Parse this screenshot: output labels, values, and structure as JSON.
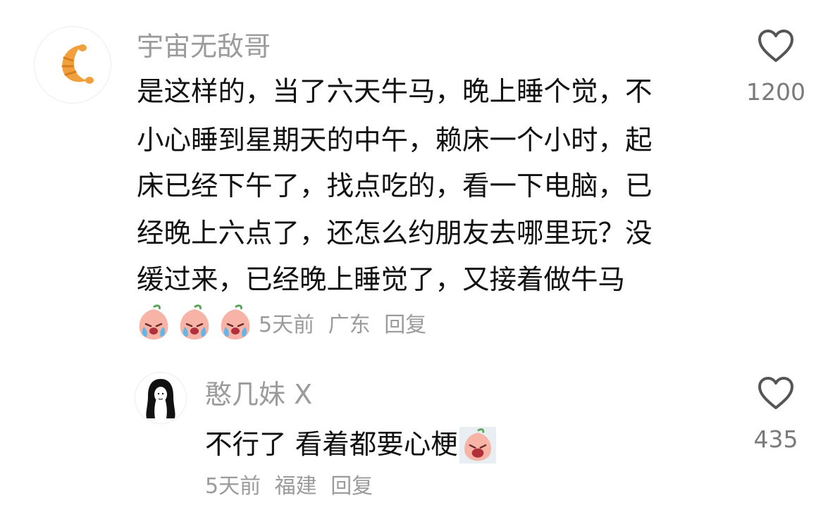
{
  "comment": {
    "username": "宇宙无敌哥",
    "avatar_icon": "croissant-icon",
    "text_lines": [
      "是这样的，当了六天牛马，晚上睡个觉，不",
      "小心睡到星期天的中午，赖床一个小时，起",
      "床已经下午了，找点吃的，看一下电脑，已",
      "经晚上六点了，还怎么约朋友去哪里玩？没",
      "缓过来，已经晚上睡觉了，又接着做牛马"
    ],
    "emojis": [
      "crying-peach-emoji",
      "crying-peach-emoji",
      "crying-peach-emoji"
    ],
    "time": "5天前",
    "location": "广东",
    "reply_label": "回复",
    "like_icon": "heart-outline-icon",
    "like_count": "1200"
  },
  "reply": {
    "username": "憨几妹 X",
    "avatar_icon": "girl-avatar-icon",
    "text": "不行了 看着都要心梗",
    "emoji": "crying-peach-emoji",
    "time": "5天前",
    "location": "福建",
    "reply_label": "回复",
    "like_icon": "heart-outline-icon",
    "like_count": "435"
  },
  "colors": {
    "username": "#9b9b9b",
    "text": "#111111",
    "meta": "#9b9b9b",
    "like_icon": "#555555",
    "croissant": "#f2a03d",
    "peach": "#f7b3a6"
  }
}
